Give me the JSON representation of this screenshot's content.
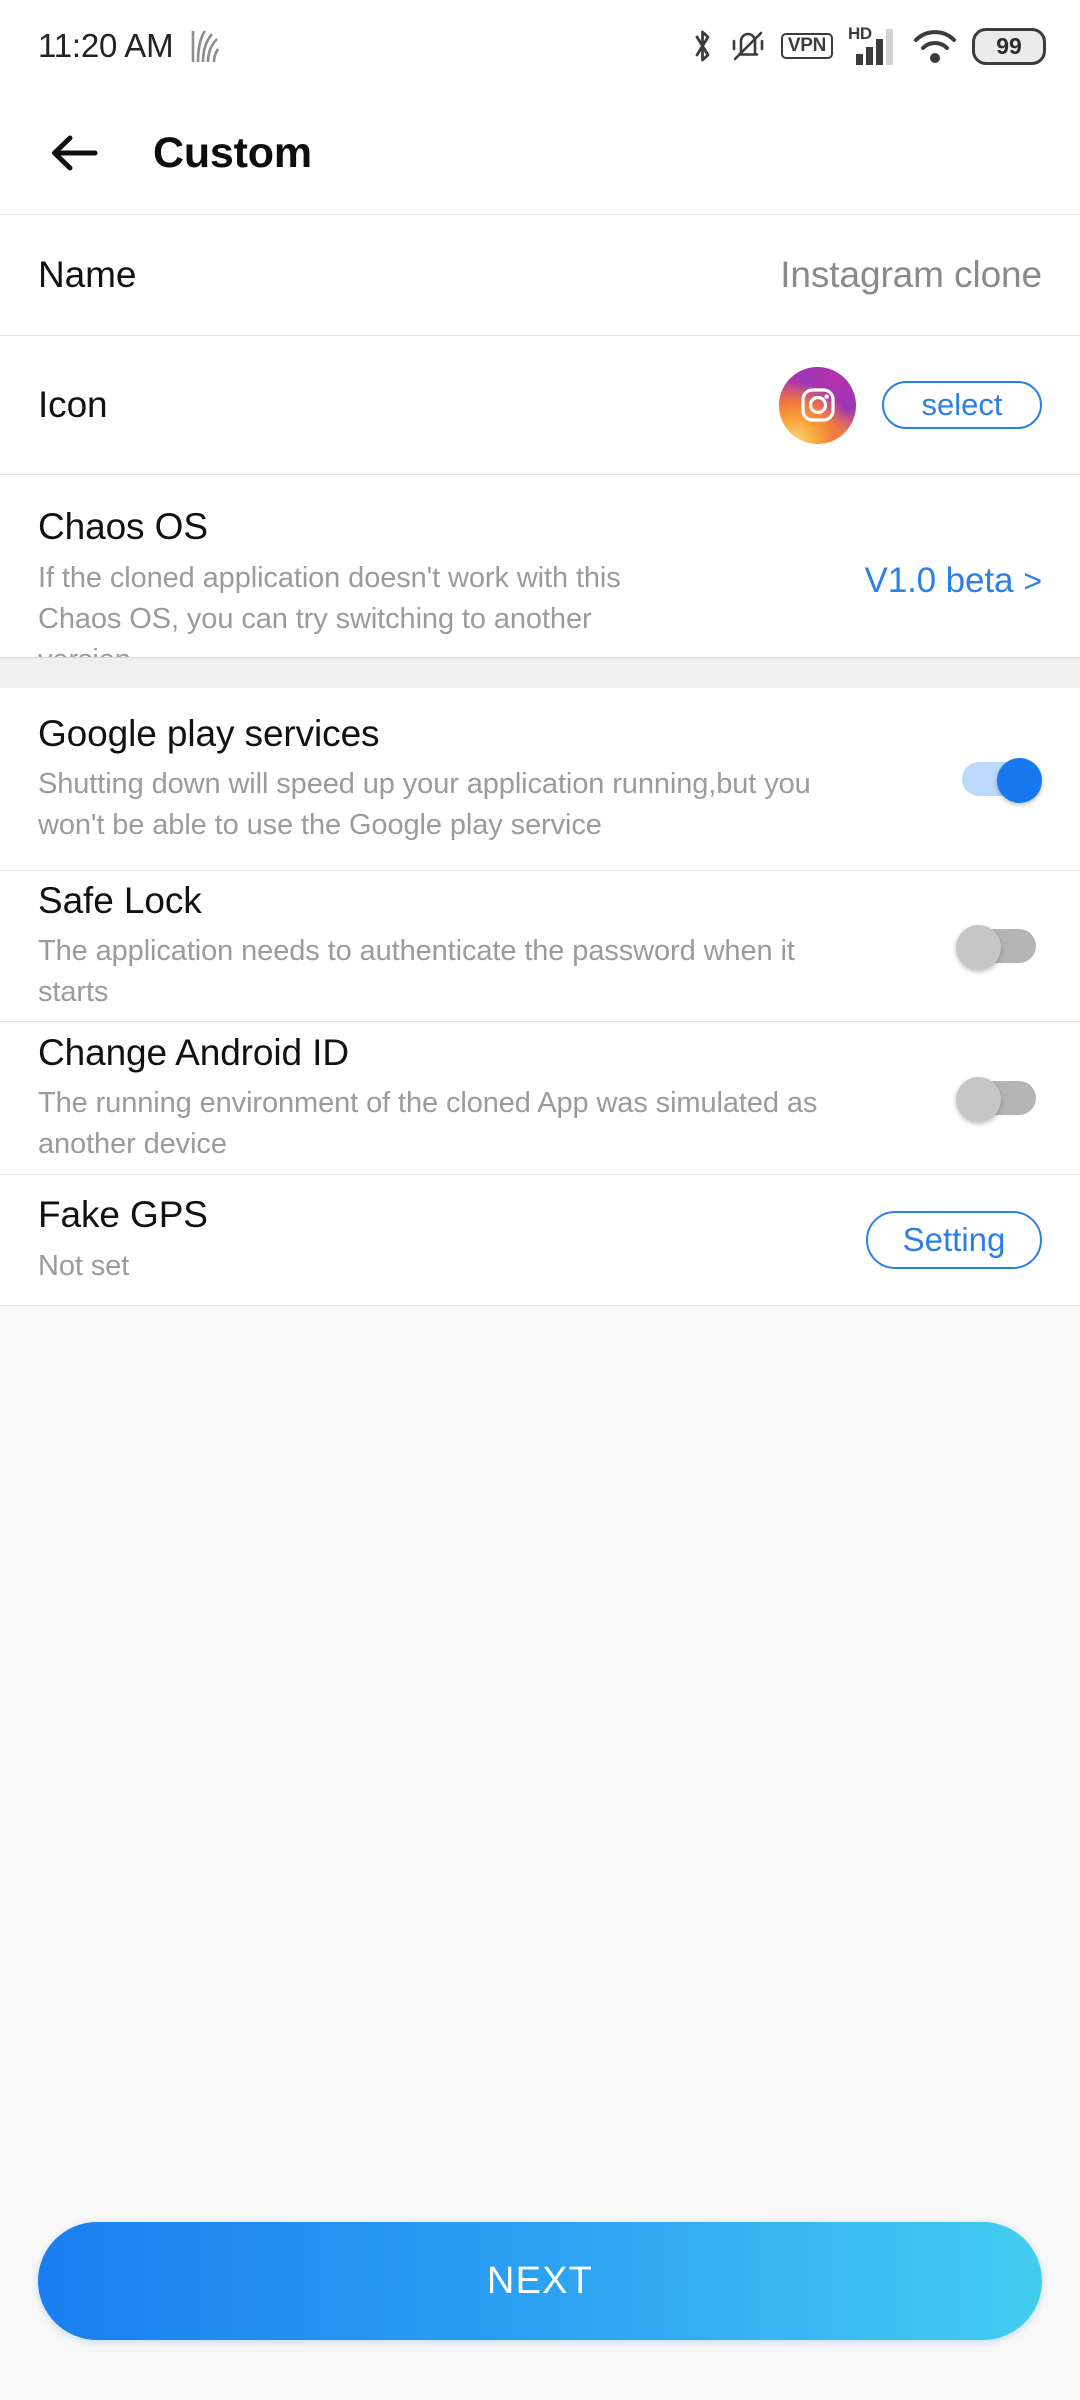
{
  "status_bar": {
    "time": "11:20 AM",
    "app_icon": "fingerprint-stripes-icon",
    "icons": [
      "bluetooth-icon",
      "vibrate-off-icon",
      "vpn-icon",
      "hd-signal-icon",
      "wifi-icon",
      "battery-icon"
    ],
    "vpn_label": "VPN",
    "hd_label": "HD",
    "battery_level": "99"
  },
  "app_bar": {
    "back_icon": "arrow-left-icon",
    "title": "Custom"
  },
  "rows": {
    "name": {
      "label": "Name",
      "value": "Instagram clone"
    },
    "icon": {
      "label": "Icon",
      "app_icon": "instagram-icon",
      "select_label": "select"
    },
    "chaos_os": {
      "title": "Chaos OS",
      "subtitle": "If the cloned application doesn't work with this Chaos OS, you can try switching to another version.",
      "version": "V1.0 beta",
      "chevron": ">"
    },
    "google_play": {
      "title": "Google play services",
      "subtitle": "Shutting down will speed up your application running,but you won't be able to use the Google play service",
      "toggle_state": "on"
    },
    "safe_lock": {
      "title": "Safe Lock",
      "subtitle": "The application needs to authenticate the password when it starts",
      "toggle_state": "off"
    },
    "change_android_id": {
      "title": "Change Android ID",
      "subtitle": "The running environment of the cloned App was simulated as another device",
      "toggle_state": "off"
    },
    "fake_gps": {
      "title": "Fake GPS",
      "subtitle": "Not set",
      "setting_label": "Setting"
    }
  },
  "footer": {
    "next_label": "NEXT"
  },
  "colors": {
    "accent_blue": "#2d7fe8",
    "toggle_on": "#1878f0",
    "toggle_off": "#c6c6c6",
    "next_gradient_start": "#1a7ef0",
    "next_gradient_end": "#44cdf0",
    "subtitle_gray": "#9b9b9b"
  }
}
